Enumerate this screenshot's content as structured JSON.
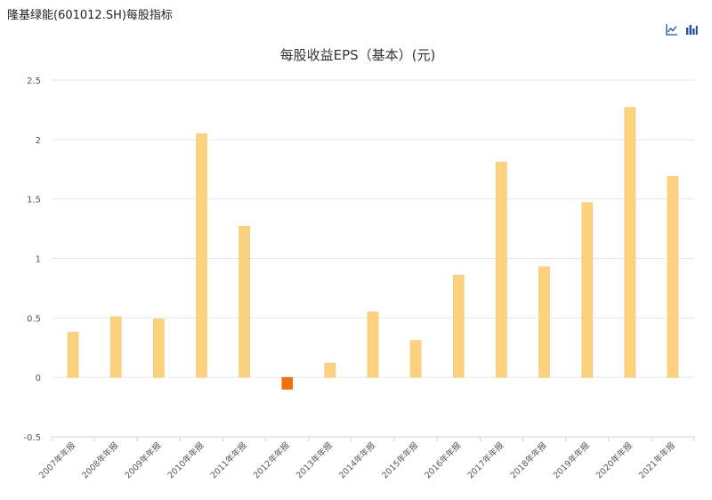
{
  "page": {
    "title": "隆基绿能(601012.SH)每股指标"
  },
  "toolbar": {
    "line_icon": "line-chart-icon",
    "bar_icon": "bar-chart-icon",
    "accent_color": "#1f4fa3"
  },
  "chart_data": {
    "type": "bar",
    "title": "每股收益EPS（基本）(元)",
    "xlabel": "",
    "ylabel": "",
    "ylim": [
      -0.5,
      2.5
    ],
    "yticks": [
      2.5,
      2,
      1.5,
      1,
      0.5,
      0,
      -0.5
    ],
    "grid": true,
    "categories": [
      "2007年年报",
      "2008年年报",
      "2009年年报",
      "2010年年报",
      "2011年年报",
      "2012年年报",
      "2013年年报",
      "2014年年报",
      "2015年年报",
      "2016年年报",
      "2017年年报",
      "2018年年报",
      "2019年年报",
      "2020年年报",
      "2021年年报"
    ],
    "values": [
      0.38,
      0.51,
      0.49,
      2.05,
      1.27,
      -0.1,
      0.12,
      0.55,
      0.31,
      0.86,
      1.81,
      0.93,
      1.47,
      2.27,
      1.69
    ],
    "colors": {
      "positive": "#fdd27f",
      "positive_edge": "#f5c26a",
      "negative": "#f26f0f"
    }
  }
}
